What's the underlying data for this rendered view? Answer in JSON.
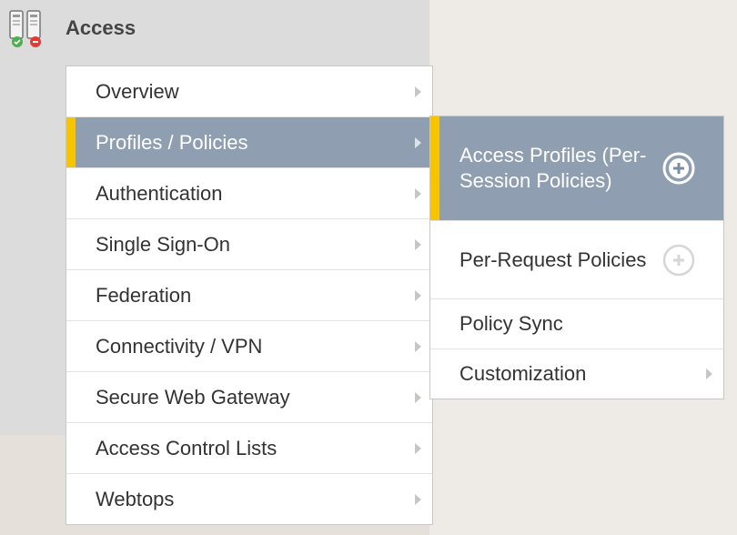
{
  "header": {
    "title": "Access",
    "icon": "access-servers-icon"
  },
  "colors": {
    "active_bg": "#8f9fb1",
    "active_marker": "#f6c400"
  },
  "menu": {
    "items": [
      {
        "label": "Overview",
        "active": false
      },
      {
        "label": "Profiles / Policies",
        "active": true
      },
      {
        "label": "Authentication",
        "active": false
      },
      {
        "label": "Single Sign-On",
        "active": false
      },
      {
        "label": "Federation",
        "active": false
      },
      {
        "label": "Connectivity / VPN",
        "active": false
      },
      {
        "label": "Secure Web Gateway",
        "active": false
      },
      {
        "label": "Access Control Lists",
        "active": false
      },
      {
        "label": "Webtops",
        "active": false
      }
    ]
  },
  "submenu": {
    "items": [
      {
        "label": "Access Profiles (Per-Session Policies)",
        "active": true,
        "action_icon": "plus-circle-icon"
      },
      {
        "label": "Per-Request Policies",
        "active": false,
        "action_icon": "plus-circle-icon"
      },
      {
        "label": "Policy Sync",
        "active": false
      },
      {
        "label": "Customization",
        "active": false,
        "has_submenu": true
      }
    ]
  }
}
